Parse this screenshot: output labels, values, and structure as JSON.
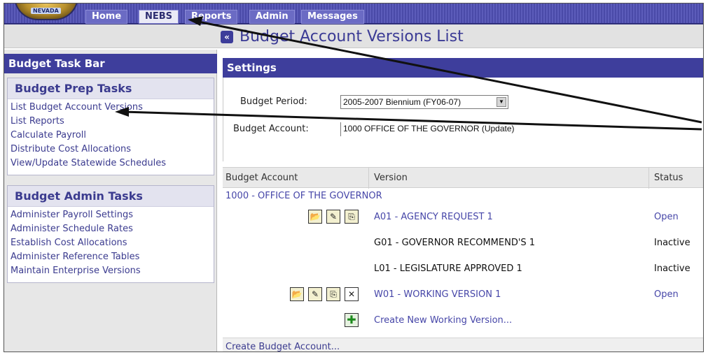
{
  "nav": {
    "logo_text": "NEVADA",
    "tabs": [
      {
        "label": "Home"
      },
      {
        "label": "NEBS"
      },
      {
        "label": "Reports"
      },
      {
        "label": "Admin"
      },
      {
        "label": "Messages"
      }
    ]
  },
  "page": {
    "title": "Budget Account Versions List"
  },
  "taskbar": {
    "title": "Budget Task Bar",
    "prep": {
      "heading": "Budget Prep Tasks",
      "items": [
        "List Budget Account Versions",
        "List Reports",
        "Calculate Payroll",
        "Distribute Cost Allocations",
        "View/Update Statewide Schedules"
      ]
    },
    "admin": {
      "heading": "Budget Admin Tasks",
      "items": [
        "Administer Payroll Settings",
        "Administer Schedule Rates",
        "Establish Cost Allocations",
        "Administer Reference Tables",
        "Maintain Enterprise Versions"
      ]
    }
  },
  "settings": {
    "heading": "Settings",
    "period_label": "Budget Period:",
    "period_value": "2005-2007 Biennium (FY06-07)",
    "account_label": "Budget Account:",
    "account_value": "1000 OFFICE OF THE GOVERNOR (Update)"
  },
  "table": {
    "headers": {
      "account": "Budget Account",
      "version": "Version",
      "status": "Status"
    },
    "account_row": "1000 - OFFICE OF THE GOVERNOR",
    "rows": [
      {
        "version": "A01 - AGENCY REQUEST 1",
        "status": "Open"
      },
      {
        "version": "G01 - GOVERNOR RECOMMEND'S 1",
        "status": "Inactive"
      },
      {
        "version": "L01 - LEGISLATURE APPROVED 1",
        "status": "Inactive"
      },
      {
        "version": "W01 - WORKING VERSION 1",
        "status": "Open"
      }
    ],
    "create_version": "Create New Working Version...",
    "create_account": "Create Budget Account..."
  },
  "colors": {
    "nav_blue": "#3e3e9c",
    "link_blue": "#4646a8",
    "arrow": "#111111"
  }
}
